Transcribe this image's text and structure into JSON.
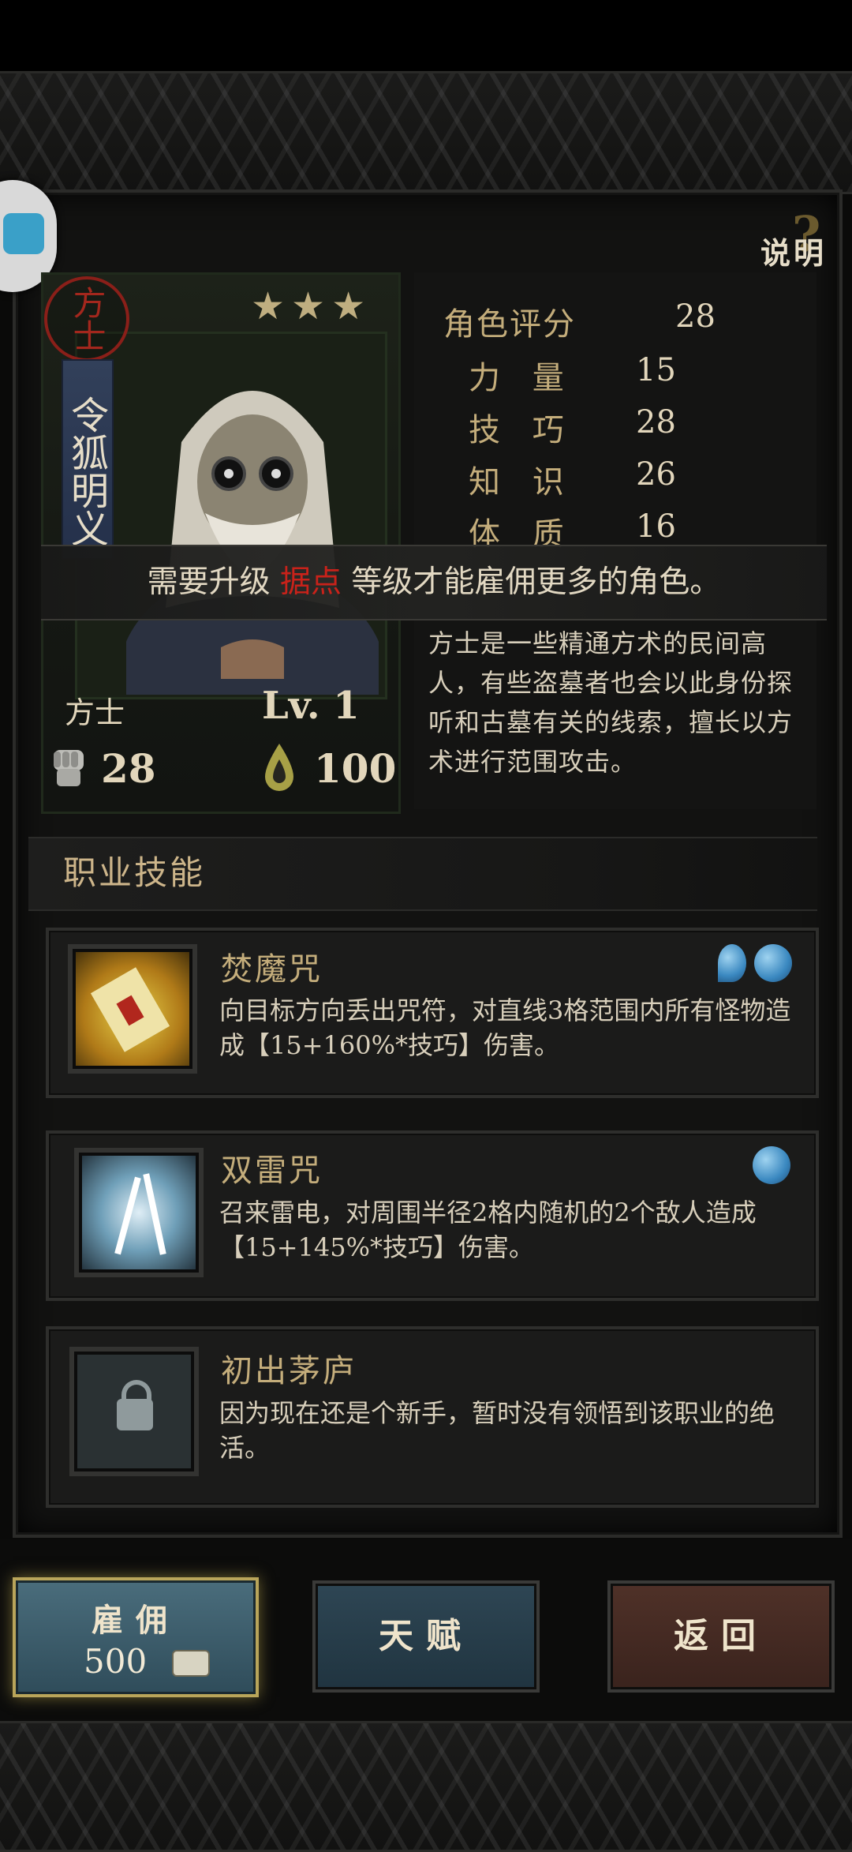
{
  "help": {
    "label": "说明"
  },
  "hero": {
    "class_seal": "方士",
    "name": "令狐明义",
    "stars": "★★★",
    "class_name": "方士",
    "level_text": "Lv. 1",
    "power": "28",
    "spirit": "100"
  },
  "stats": [
    {
      "label": "角色评分",
      "value": "28"
    },
    {
      "label": "力 量",
      "value": "15"
    },
    {
      "label": "技 巧",
      "value": "28"
    },
    {
      "label": "知 识",
      "value": "26"
    },
    {
      "label": "体 质",
      "value": "16"
    }
  ],
  "notice": {
    "before": "需要升级 ",
    "highlight": "据点",
    "after": " 等级才能雇佣更多的角色。"
  },
  "class_description": "方士是一些精通方术的民间高人，有些盗墓者也会以此身份探听和古墓有关的线索，擅长以方术进行范围攻击。",
  "skills_section": {
    "title": "职业技能"
  },
  "skills": [
    {
      "name": "焚魔咒",
      "desc": "向目标方向丢出咒符，对直线3格范围内所有怪物造成【15+160%*技巧】伤害。"
    },
    {
      "name": "双雷咒",
      "desc": "召来雷电，对周围半径2格内随机的2个敌人造成【15+145%*技巧】伤害。"
    },
    {
      "name": "初出茅庐",
      "desc": "因为现在还是个新手，暂时没有领悟到该职业的绝活。"
    }
  ],
  "buttons": {
    "hire_label": "雇佣",
    "hire_cost": "500",
    "talent_label": "天赋",
    "back_label": "返回"
  },
  "colors": {
    "highlight_red": "#c9221a",
    "hire_button": "#3b5a6a",
    "back_button": "#4a2d25",
    "gold_text": "#c4ad7b"
  }
}
